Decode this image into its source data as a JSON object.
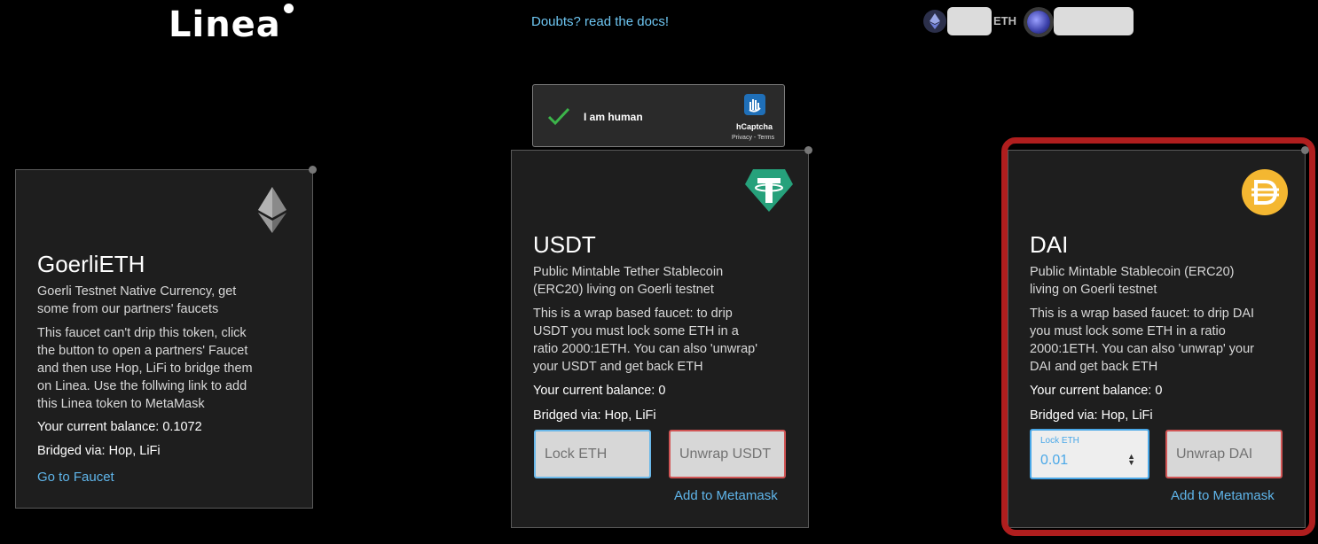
{
  "header": {
    "logo_text": "Linea",
    "docs_link": "Doubts? read the docs!",
    "wallet": {
      "unit": "ETH"
    }
  },
  "captcha": {
    "label": "I am human",
    "brand": "hCaptcha",
    "terms": "Privacy - Terms"
  },
  "cards": [
    {
      "icon": "ethereum-icon",
      "title": "GoerliETH",
      "description_lines": [
        "Goerli Testnet Native Currency, get",
        "some from our partners' faucets"
      ],
      "note_lines": [
        "This faucet can't drip this token, click",
        "the button to open a partners' Faucet",
        "and then use Hop, LiFi to bridge them",
        "on Linea. Use the follwing link to add",
        "this Linea token to MetaMask"
      ],
      "balance": "Your current balance: 0.1072",
      "bridged": "Bridged via: Hop, LiFi",
      "action_link": "Go to Faucet"
    },
    {
      "icon": "tether-icon",
      "title": "USDT",
      "description_lines": [
        "Public Mintable Tether Stablecoin",
        "(ERC20) living on Goerli testnet"
      ],
      "note_lines": [
        "This is a wrap based faucet: to drip",
        "USDT you must lock some ETH in a",
        "ratio 2000:1ETH. You can also 'unwrap'",
        "your USDT and get back ETH"
      ],
      "balance": "Your current balance: 0",
      "bridged": "Bridged via: Hop, LiFi",
      "lock_placeholder": "Lock ETH",
      "unwrap_placeholder": "Unwrap USDT",
      "action_link": "Add to Metamask"
    },
    {
      "icon": "dai-icon",
      "title": "DAI",
      "description_lines": [
        "Public Mintable Stablecoin (ERC20)",
        "living on Goerli testnet"
      ],
      "note_lines": [
        "This is a wrap based faucet: to drip DAI",
        "you must lock some ETH in a ratio",
        "2000:1ETH. You can also 'unwrap' your",
        "DAI and get back ETH"
      ],
      "balance": "Your current balance: 0",
      "bridged": "Bridged via: Hop, LiFi",
      "lock_label": "Lock ETH",
      "lock_value": "0.01",
      "unwrap_placeholder": "Unwrap DAI",
      "action_link": "Add to Metamask"
    }
  ],
  "colors": {
    "accent": "#5fb5ea",
    "highlight": "#b01e1e",
    "tether": "#26a17b",
    "dai": "#f4b731"
  }
}
